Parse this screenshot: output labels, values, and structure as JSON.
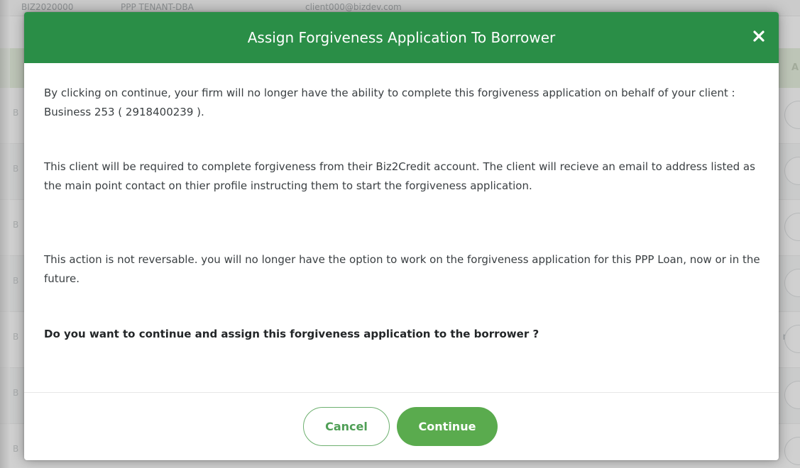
{
  "background": {
    "topbar_items": [
      "BIZ2020000",
      "PPP TENANT-DBA",
      "client000@bizdev.com"
    ],
    "right_edge_header": "A",
    "right_edge_row_text": "rt"
  },
  "modal": {
    "title": "Assign Forgiveness Application To Borrower",
    "close_icon": "close-icon",
    "paragraphs": [
      "By clicking on continue, your firm will no longer have the ability to complete this forgiveness application on behalf of your client : Business 253 ( 2918400239 ).",
      "This client will be required to complete forgiveness from their Biz2Credit account. The client will recieve an email to address listed as the main point contact on thier profile instructing them to start the forgiveness application.",
      "This action is not reversable. you will no longer have the option to work on the forgiveness application for this PPP Loan, now or in the future."
    ],
    "question": "Do you want to continue and assign this forgiveness application to the borrower ?",
    "cancel_label": "Cancel",
    "continue_label": "Continue"
  },
  "colors": {
    "header_green": "#2a8e47",
    "button_green": "#5aab4e",
    "cancel_border": "#6db06f",
    "row_header_green": "#e2efd9"
  }
}
